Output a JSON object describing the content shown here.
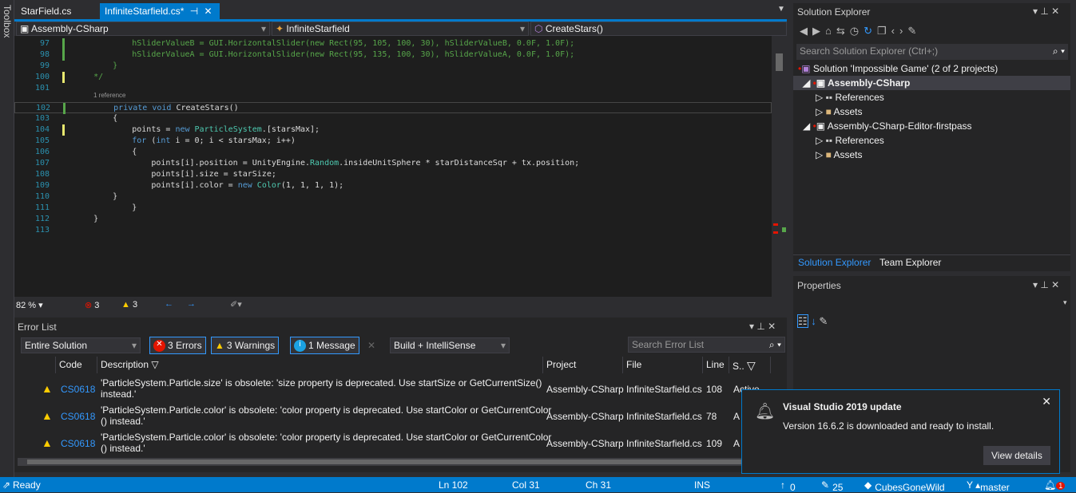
{
  "toolbox": {
    "label": "Toolbox"
  },
  "tabs": [
    {
      "label": "StarField.cs",
      "active": false
    },
    {
      "label": "InfiniteStarfield.cs*",
      "active": true
    }
  ],
  "nav": {
    "project": "Assembly-CSharp",
    "class": "InfiniteStarfield",
    "member": "CreateStars()"
  },
  "editor": {
    "codelens": "1 reference",
    "lines": [
      {
        "n": "97",
        "tokens": [
          [
            "c",
            "            hSliderValueB = GUI.HorizontalSlider(new Rect(95, 105, 100, 30), hSliderValueB, 0.0F, 1.0F);"
          ]
        ]
      },
      {
        "n": "98",
        "tokens": [
          [
            "c",
            "            hSliderValueA = GUI.HorizontalSlider(new Rect(95, 135, 100, 30), hSliderValueA, 0.0F, 1.0F);"
          ]
        ]
      },
      {
        "n": "99",
        "tokens": [
          [
            "c",
            "        }"
          ]
        ]
      },
      {
        "n": "100",
        "tokens": [
          [
            "c",
            "    */"
          ]
        ]
      },
      {
        "n": "101",
        "tokens": []
      },
      {
        "n": "102",
        "tokens": [
          [
            "k",
            "        private void "
          ],
          [
            "p",
            "CreateStars()"
          ]
        ]
      },
      {
        "n": "103",
        "tokens": [
          [
            "p",
            "        {"
          ]
        ]
      },
      {
        "n": "104",
        "tokens": [
          [
            "p",
            "            points = "
          ],
          [
            "k",
            "new "
          ],
          [
            "t",
            "ParticleSystem"
          ],
          [
            "p",
            ".[starsMax];"
          ]
        ]
      },
      {
        "n": "105",
        "tokens": [
          [
            "k",
            "            for "
          ],
          [
            "p",
            "("
          ],
          [
            "k",
            "int"
          ],
          [
            "p",
            " i = 0; i < starsMax; i++)"
          ]
        ]
      },
      {
        "n": "106",
        "tokens": [
          [
            "p",
            "            {"
          ]
        ]
      },
      {
        "n": "107",
        "tokens": [
          [
            "p",
            "                points[i].position = UnityEngine."
          ],
          [
            "t",
            "Random"
          ],
          [
            "p",
            ".insideUnitSphere * starDistanceSqr + tx.position;"
          ]
        ]
      },
      {
        "n": "108",
        "tokens": [
          [
            "p",
            "                points[i].size = starSize;"
          ]
        ]
      },
      {
        "n": "109",
        "tokens": [
          [
            "p",
            "                points[i].color = "
          ],
          [
            "k",
            "new "
          ],
          [
            "t",
            "Color"
          ],
          [
            "p",
            "(1, 1, 1, 1);"
          ]
        ]
      },
      {
        "n": "110",
        "tokens": [
          [
            "p",
            "        }"
          ]
        ]
      },
      {
        "n": "111",
        "tokens": [
          [
            "p",
            "            }"
          ]
        ]
      },
      {
        "n": "112",
        "tokens": [
          [
            "p",
            "    }"
          ]
        ]
      },
      {
        "n": "113",
        "tokens": []
      }
    ]
  },
  "zoombar": {
    "zoom": "82 %",
    "errors": "3",
    "warnings": "3"
  },
  "errorList": {
    "title": "Error List",
    "scope": "Entire Solution",
    "errors_btn": "3 Errors",
    "warnings_btn": "3 Warnings",
    "messages_btn": "1 Message",
    "source": "Build + IntelliSense",
    "search_placeholder": "Search Error List",
    "columns": {
      "code": "Code",
      "description": "Description",
      "project": "Project",
      "file": "File",
      "line": "Line",
      "state": "S.."
    },
    "rows": [
      {
        "code": "CS0618",
        "desc1": "'ParticleSystem.Particle.size' is obsolete: 'size property is deprecated. Use startSize or GetCurrentSize()",
        "desc2": "instead.'",
        "project": "Assembly-CSharp",
        "file": "InfiniteStarfield.cs",
        "line": "108",
        "state": "Active"
      },
      {
        "code": "CS0618",
        "desc1": "'ParticleSystem.Particle.color' is obsolete: 'color property is deprecated. Use startColor or GetCurrentColor",
        "desc2": "() instead.'",
        "project": "Assembly-CSharp",
        "file": "InfiniteStarfield.cs",
        "line": "78",
        "state": "A"
      },
      {
        "code": "CS0618",
        "desc1": "'ParticleSystem.Particle.color' is obsolete: 'color property is deprecated. Use startColor or GetCurrentColor",
        "desc2": "() instead.'",
        "project": "Assembly-CSharp",
        "file": "InfiniteStarfield.cs",
        "line": "109",
        "state": "A"
      }
    ]
  },
  "solutionExplorer": {
    "title": "Solution Explorer",
    "search_placeholder": "Search Solution Explorer (Ctrl+;)",
    "solution": "Solution 'Impossible Game' (2 of 2 projects)",
    "items": [
      {
        "label": "Assembly-CSharp",
        "level": 1,
        "bold": true
      },
      {
        "label": "References",
        "level": 2
      },
      {
        "label": "Assets",
        "level": 2
      },
      {
        "label": "Assembly-CSharp-Editor-firstpass",
        "level": 1
      },
      {
        "label": "References",
        "level": 2
      },
      {
        "label": "Assets",
        "level": 2
      }
    ],
    "tabs": [
      "Solution Explorer",
      "Team Explorer"
    ]
  },
  "properties": {
    "title": "Properties"
  },
  "notification": {
    "title": "Visual Studio 2019 update",
    "body": "Version 16.6.2 is downloaded and ready to install.",
    "button": "View details"
  },
  "status": {
    "ready": "Ready",
    "ln": "Ln 102",
    "col": "Col 31",
    "ch": "Ch 31",
    "mode": "INS",
    "push": "0",
    "changes": "25",
    "repo": "CubesGoneWild",
    "branch": "master",
    "notifications": "1"
  },
  "colors": {
    "accent": "#007acc",
    "error": "#e51400",
    "warning": "#ffcc00",
    "info": "#1ba1e2"
  }
}
